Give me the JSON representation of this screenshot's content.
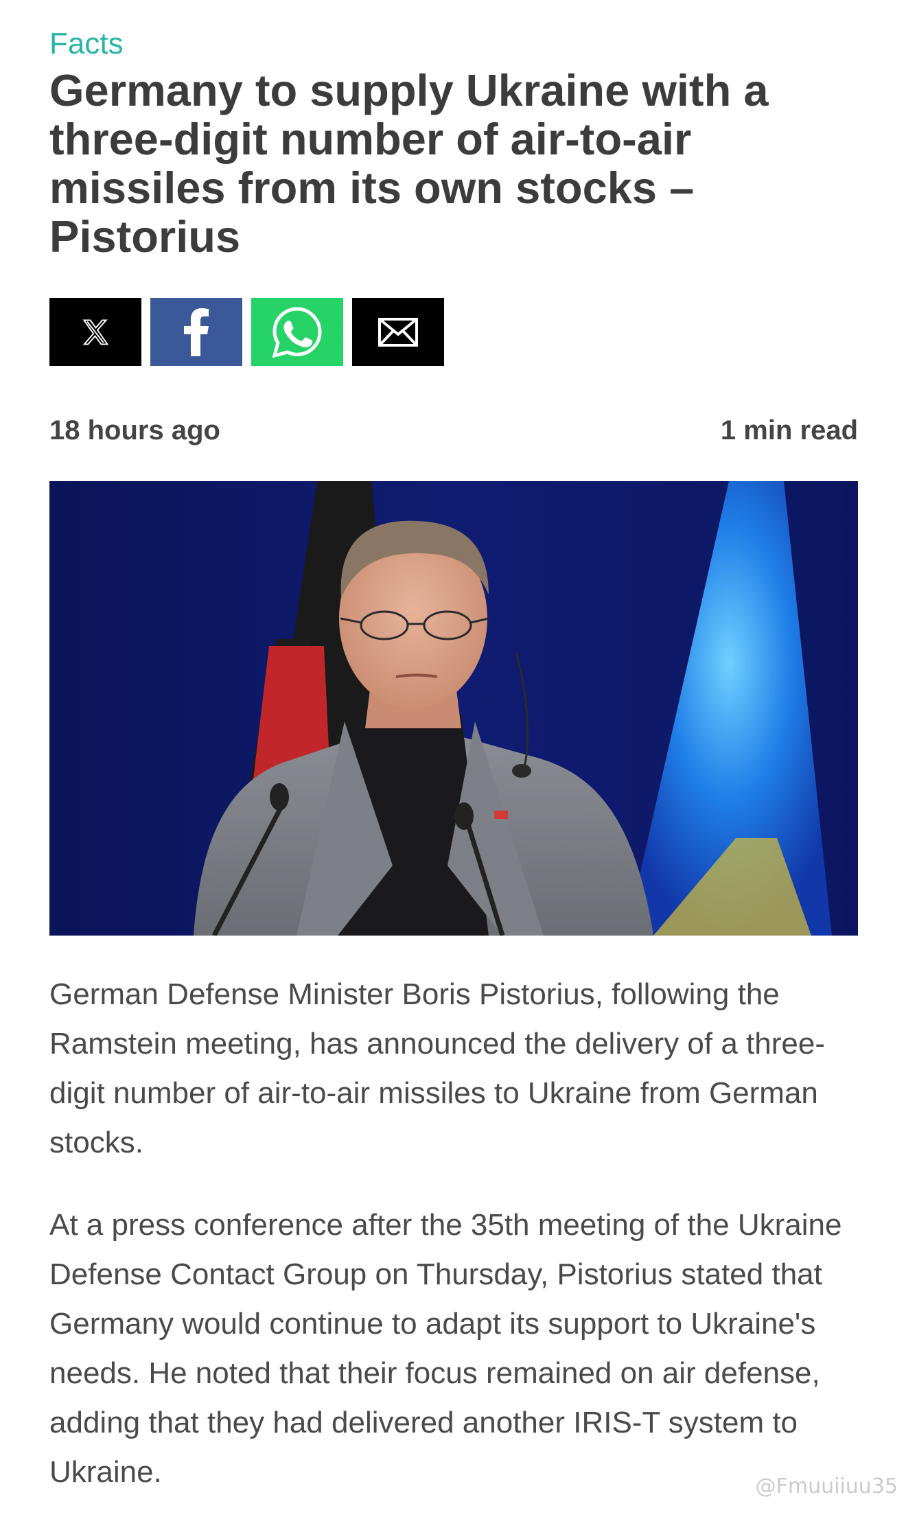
{
  "article": {
    "category": "Facts",
    "headline": "Germany to supply Ukraine with a three-digit number of air-to-air missiles from its own stocks – Pistorius",
    "published": "18 hours ago",
    "read_time": "1 min read",
    "paragraphs": [
      "German Defense Minister Boris Pistorius, following the Ramstein meeting, has announced the delivery of a three-digit number of air-to-air missiles to Ukraine from German stocks.",
      "At a press conference after the 35th meeting of the Ukraine Defense Contact Group on Thursday, Pistorius stated that Germany would continue to adapt its support to Ukraine's needs. He noted that their focus remained on air defense, adding that they had delivered another IRIS-T system to Ukraine."
    ]
  },
  "share": [
    {
      "icon": "x-logo-icon",
      "bg": "#000000"
    },
    {
      "icon": "facebook-icon",
      "bg": "#3b5998"
    },
    {
      "icon": "whatsapp-icon",
      "bg": "#25d366"
    },
    {
      "icon": "email-icon",
      "bg": "#000000"
    }
  ],
  "colors": {
    "accent": "#2ab3a6",
    "headline": "#3c3c3c",
    "body_text": "#4a4a4a"
  },
  "watermark": "@Fmuuiiuu35"
}
